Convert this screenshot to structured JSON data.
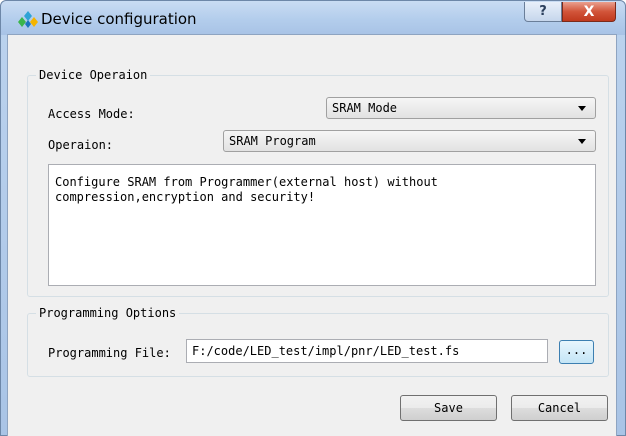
{
  "window": {
    "title": "Device configuration",
    "help_label": "?",
    "close_label": "X"
  },
  "device_group": {
    "legend": "Device Operaion",
    "access_mode_label": "Access Mode:",
    "access_mode_value": "SRAM Mode",
    "operation_label": "Operaion:",
    "operation_value": "SRAM Program",
    "description": "Configure SRAM from Programmer(external host) without\ncompression,encryption and security!"
  },
  "programming_group": {
    "legend": "Programming Options",
    "file_label": "Programming File:",
    "file_value": "F:/code/LED_test/impl/pnr/LED_test.fs",
    "browse_label": "..."
  },
  "buttons": {
    "save_label": "Save",
    "cancel_label": "Cancel"
  },
  "icons": {
    "app": "gowin-logo-icon",
    "help": "question-icon",
    "close": "close-icon",
    "dropdown": "chevron-down-icon"
  },
  "colors": {
    "titlebar": "#b3cdec",
    "client_bg": "#f0f0f0",
    "close_button": "#c0391d",
    "browse_button": "#c4e5f6"
  }
}
